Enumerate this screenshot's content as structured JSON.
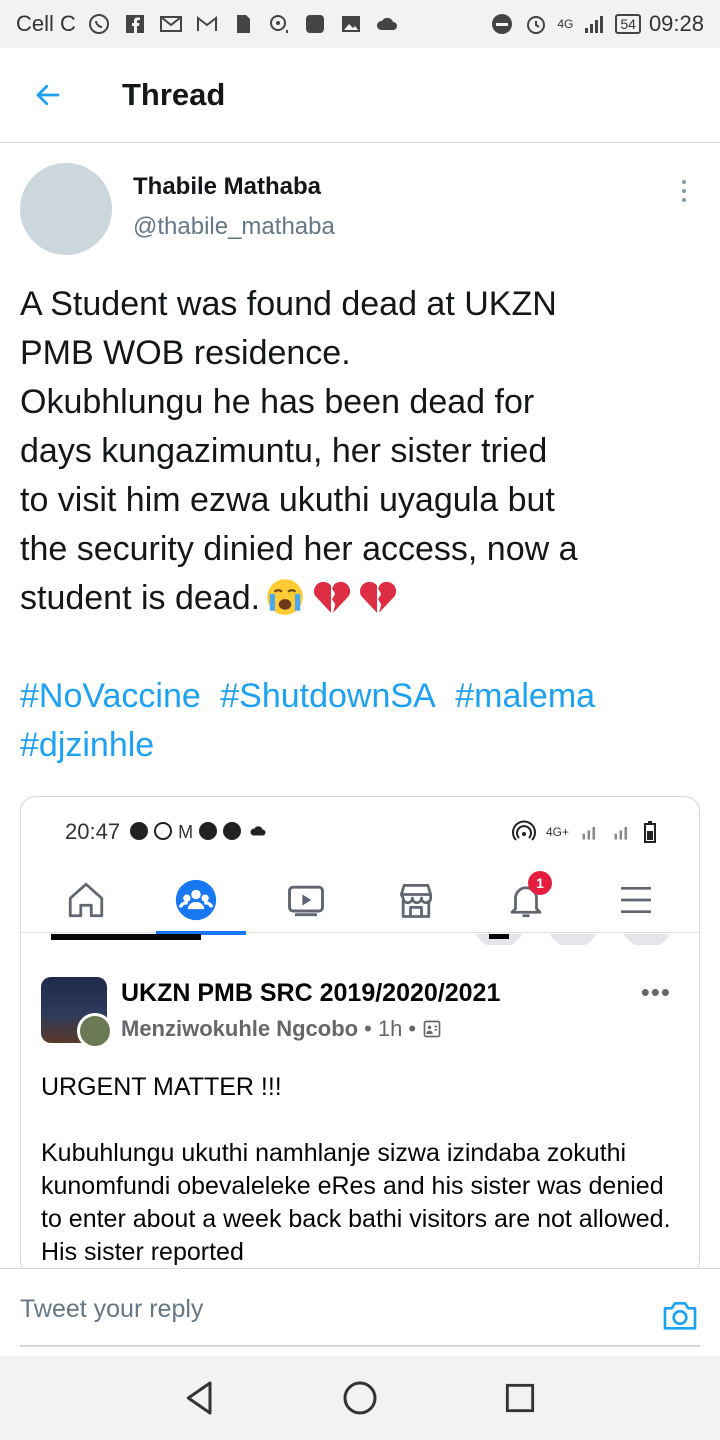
{
  "status_bar": {
    "carrier": "Cell C",
    "network": "4G",
    "battery": "54",
    "time": "09:28",
    "icons": [
      "whatsapp-icon",
      "facebook-icon",
      "mail-icon",
      "gmail-icon",
      "sim-icon",
      "camera-lens-icon",
      "app-icon",
      "gallery-icon",
      "cloud-icon",
      "dnd-icon",
      "alarm-icon",
      "signal-icon"
    ]
  },
  "header": {
    "title": "Thread",
    "back_icon": "arrow-left-icon"
  },
  "tweet": {
    "author_name": "Thabile Mathaba",
    "author_handle": "@thabile_mathaba",
    "lines": [
      "A Student was found dead at UKZN",
      "PMB WOB residence.",
      "Okubhlungu he has been dead for",
      "days kungazimuntu, her sister tried",
      "to visit him ezwa ukuthi uyagula but",
      "the security dinied her access, now a",
      "student is dead."
    ],
    "emojis": [
      "crying-face-icon",
      "broken-heart-icon",
      "broken-heart-icon"
    ],
    "hashtags": [
      "#NoVaccine",
      "#ShutdownSA",
      "#malema",
      "#djzinhle"
    ],
    "accent_color": "#1da1f2"
  },
  "embedded_screenshot": {
    "time": "20:47",
    "network": "4G+",
    "nav_tabs": [
      "home-icon",
      "groups-icon",
      "watch-icon",
      "marketplace-icon",
      "notifications-icon",
      "menu-icon"
    ],
    "notification_count": "1",
    "group_name": "UKZN PMB SRC 2019/2020/2021",
    "poster_name": "Menziwokuhle Ngcobo",
    "post_time": "1h",
    "separator": "•",
    "post_paragraphs": [
      "URGENT MATTER !!!",
      "Kubuhlungu ukuthi namhlanje sizwa izindaba zokuthi kunomfundi obevaleleke eRes and his sister was denied to enter about a week back bathi visitors are not allowed. His sister reported"
    ],
    "brand_color": "#1877f2"
  },
  "reply": {
    "placeholder": "Tweet your reply"
  }
}
